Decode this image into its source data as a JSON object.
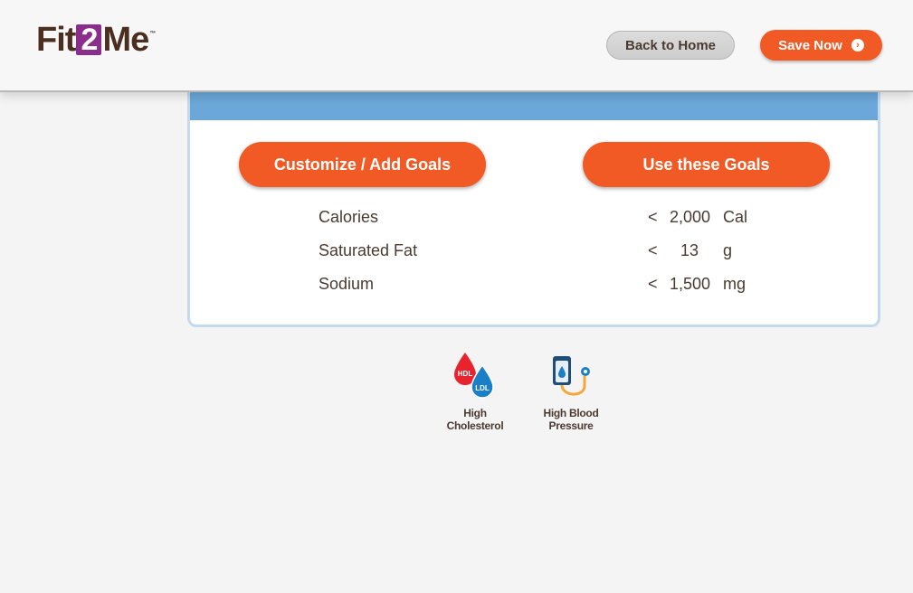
{
  "header": {
    "logo": {
      "part1": "Fit",
      "part2": "2",
      "part3": "Me",
      "tm": "™"
    },
    "back_label": "Back to Home",
    "save_label": "Save Now"
  },
  "panel": {
    "customize_label": "Customize / Add Goals",
    "use_label": "Use these Goals",
    "goals": [
      {
        "name": "Calories",
        "op": "<",
        "value": "2,000",
        "unit": "Cal"
      },
      {
        "name": "Saturated Fat",
        "op": "<",
        "value": "13",
        "unit": "g"
      },
      {
        "name": "Sodium",
        "op": "<",
        "value": "1,500",
        "unit": "mg"
      }
    ]
  },
  "conditions": [
    {
      "label": "High Cholesterol",
      "icon": "cholesterol-drops-icon",
      "hdl": "HDL",
      "ldl": "LDL"
    },
    {
      "label": "High Blood Pressure",
      "icon": "blood-pressure-cuff-icon"
    }
  ],
  "colors": {
    "accent": "#f15a24",
    "brand_purple": "#8b2d8b",
    "brand_brown": "#4b2e20",
    "panel_bar": "#6ba7d8",
    "hdl_red": "#e8232e",
    "ldl_blue": "#1a7fc4"
  }
}
